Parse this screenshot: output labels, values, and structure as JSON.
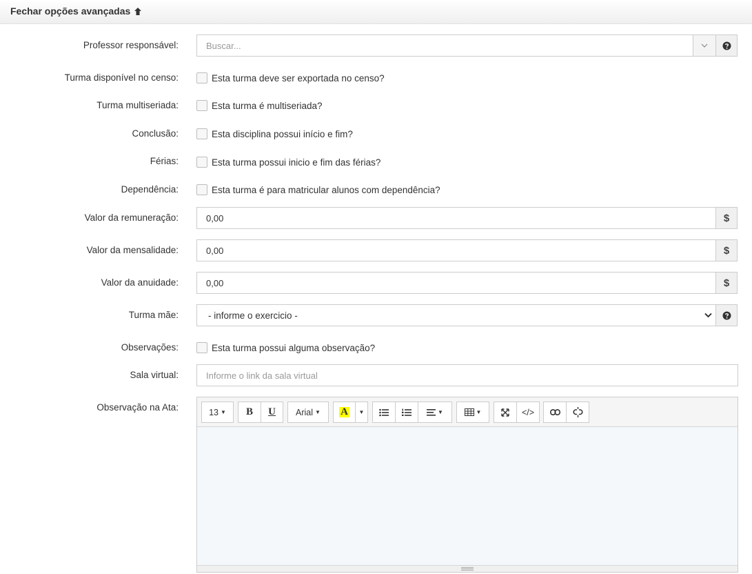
{
  "header": {
    "toggle_label": "Fechar opções avançadas"
  },
  "fields": {
    "professor": {
      "label": "Professor responsável:",
      "placeholder": "Buscar..."
    },
    "censo": {
      "label": "Turma disponível no censo:",
      "check_label": "Esta turma deve ser exportada no censo?"
    },
    "multiseriada": {
      "label": "Turma multiseriada:",
      "check_label": "Esta turma é multiseriada?"
    },
    "conclusao": {
      "label": "Conclusão:",
      "check_label": "Esta disciplina possui início e fim?"
    },
    "ferias": {
      "label": "Férias:",
      "check_label": "Esta turma possui inicio e fim das férias?"
    },
    "dependencia": {
      "label": "Dependência:",
      "check_label": "Esta turma é para matricular alunos com dependência?"
    },
    "remuneracao": {
      "label": "Valor da remuneração:",
      "value": "0,00",
      "addon": "$"
    },
    "mensalidade": {
      "label": "Valor da mensalidade:",
      "value": "0,00",
      "addon": "$"
    },
    "anuidade": {
      "label": "Valor da anuidade:",
      "value": "0,00",
      "addon": "$"
    },
    "turma_mae": {
      "label": "Turma mãe:",
      "selected": "- informe o exercicio -"
    },
    "observacoes": {
      "label": "Observações:",
      "check_label": "Esta turma possui alguma observação?"
    },
    "sala_virtual": {
      "label": "Sala virtual:",
      "placeholder": "Informe o link da sala virtual"
    },
    "observacao_ata": {
      "label": "Observação na Ata:"
    }
  },
  "editor": {
    "font_size": "13",
    "bold": "B",
    "underline": "U",
    "font_name": "Arial",
    "highlight": "A",
    "code": "</>"
  },
  "colors": {
    "highlight": "#ffff00",
    "border": "#cccccc",
    "addon_bg": "#f0f0f0"
  }
}
